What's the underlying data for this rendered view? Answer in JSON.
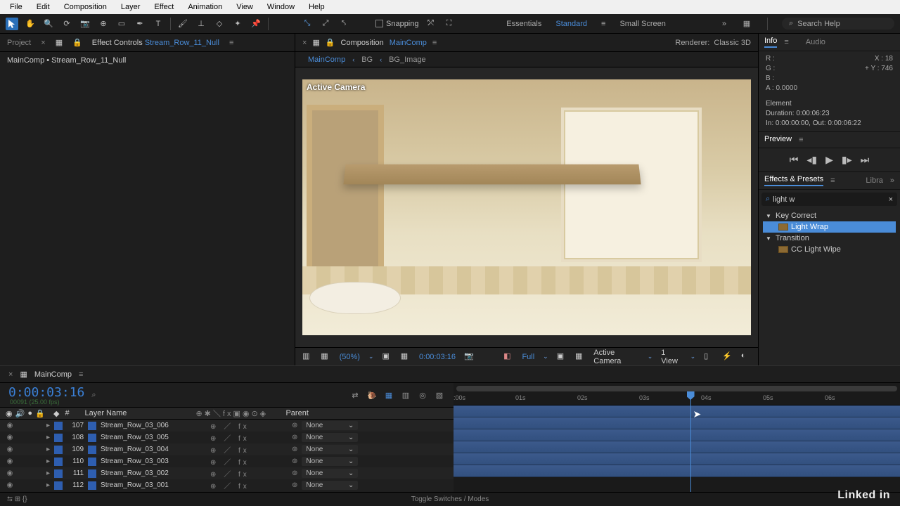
{
  "menu": {
    "items": [
      "File",
      "Edit",
      "Composition",
      "Layer",
      "Effect",
      "Animation",
      "View",
      "Window",
      "Help"
    ]
  },
  "toolbar": {
    "snapping": "Snapping"
  },
  "workspaces": {
    "items": [
      "Essentials",
      "Standard",
      "Small Screen"
    ],
    "active": 1
  },
  "search": {
    "placeholder": "Search Help"
  },
  "leftPanel": {
    "projectTab": "Project",
    "effectControlsTab": "Effect Controls",
    "effectControlsTarget": "Stream_Row_11_Null",
    "breadcrumb": "MainComp • Stream_Row_11_Null"
  },
  "compositionPanel": {
    "label": "Composition",
    "name": "MainComp",
    "nav": {
      "active": "MainComp",
      "bg": "BG",
      "bgImage": "BG_Image"
    },
    "rendererLabel": "Renderer:",
    "renderer": "Classic 3D",
    "activeCamera": "Active Camera"
  },
  "viewerControls": {
    "magnification": "(50%)",
    "timecode": "0:00:03:16",
    "resolution": "Full",
    "camera": "Active Camera",
    "view": "1 View"
  },
  "rightPanel": {
    "infoTab": "Info",
    "audioTab": "Audio",
    "info": {
      "r": "R :",
      "g": "G :",
      "b": "B :",
      "a": "A :",
      "aVal": "0.0000",
      "x": "X : 18",
      "y": "Y : 746"
    },
    "element": {
      "title": "Element",
      "duration": "Duration: 0:00:06:23",
      "inout": "In: 0:00:00:00, Out: 0:00:06:22"
    },
    "previewTab": "Preview",
    "effectsTab": "Effects & Presets",
    "libraTab": "Libra",
    "searchValue": "light w",
    "tree": {
      "keyCorrect": "Key Correct",
      "lightWrap": "Light Wrap",
      "transition": "Transition",
      "ccLightWipe": "CC Light Wipe"
    }
  },
  "timeline": {
    "tab": "MainComp",
    "timecode": "0:00:03:16",
    "subtime": "00091 (25.00 fps)",
    "layerNameHeader": "Layer Name",
    "parentHeader": "Parent",
    "noneLabel": "None",
    "layers": [
      {
        "num": "107",
        "name": "Stream_Row_03_006"
      },
      {
        "num": "108",
        "name": "Stream_Row_03_005"
      },
      {
        "num": "109",
        "name": "Stream_Row_03_004"
      },
      {
        "num": "110",
        "name": "Stream_Row_03_003"
      },
      {
        "num": "111",
        "name": "Stream_Row_03_002"
      },
      {
        "num": "112",
        "name": "Stream_Row_03_001"
      }
    ],
    "ruler": [
      ":00s",
      "01s",
      "02s",
      "03s",
      "04s",
      "05s",
      "06s"
    ],
    "playheadPercent": 53,
    "footer": "Toggle Switches / Modes"
  },
  "brand": "Linked in"
}
